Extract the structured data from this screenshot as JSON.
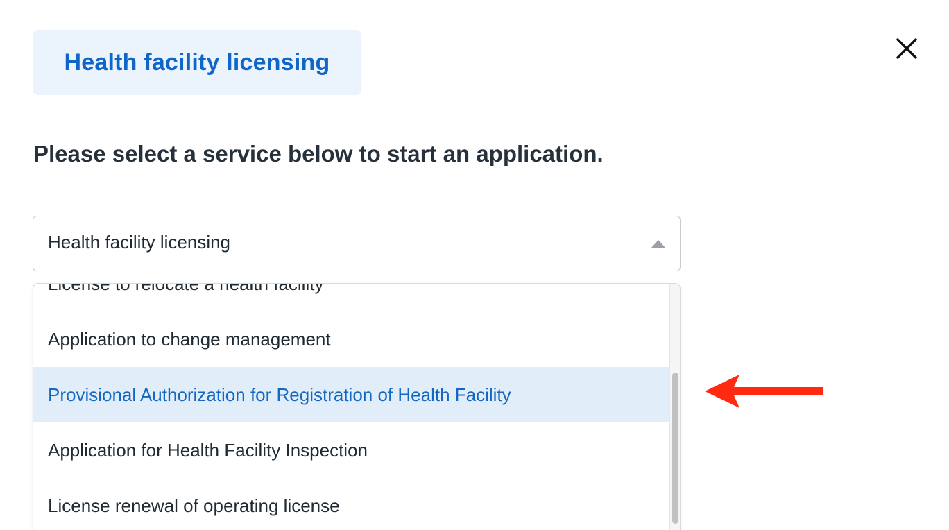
{
  "header": {
    "category_label": "Health facility licensing"
  },
  "prompt": {
    "heading": "Please select a service below to start an application."
  },
  "service_select": {
    "selected_value": "Health facility licensing"
  },
  "dropdown": {
    "options": [
      {
        "label": "License to relocate a health facility"
      },
      {
        "label": "Application to change management"
      },
      {
        "label": "Provisional Authorization for Registration of Health Facility"
      },
      {
        "label": "Application for Health Facility Inspection"
      },
      {
        "label": "License renewal of operating license"
      }
    ],
    "highlighted_index": 2
  },
  "icons": {
    "close": "close-icon",
    "caret": "caret-up-icon",
    "annotation": "arrow-left-icon"
  },
  "colors": {
    "accent": "#0f66c8",
    "chip_background": "#ebf3fd",
    "highlight_background": "#e1eef9",
    "annotation_red": "#ff2a10"
  }
}
